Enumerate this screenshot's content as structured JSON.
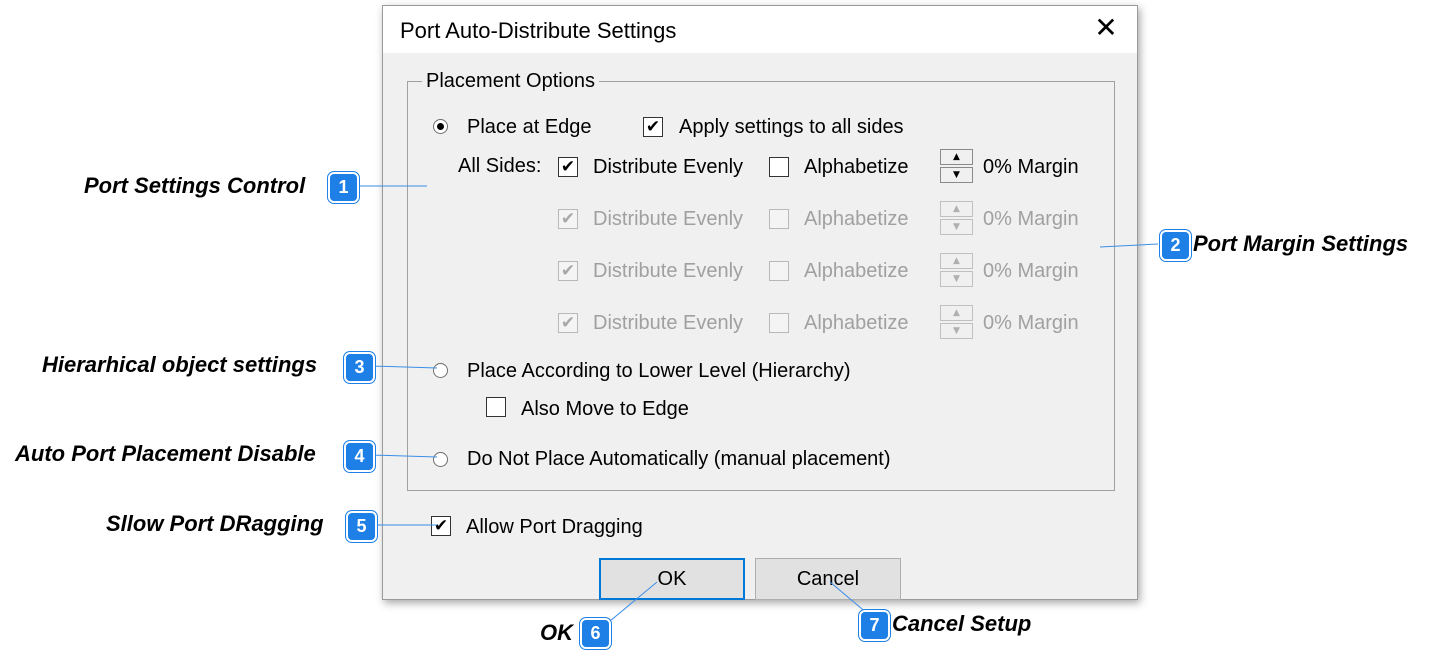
{
  "dialog": {
    "title": "Port Auto-Distribute Settings",
    "close_glyph": "✕"
  },
  "placement": {
    "group_title": "Placement Options",
    "place_at_edge": "Place at Edge",
    "apply_all_sides": "Apply settings to all sides",
    "all_sides_label": "All Sides:",
    "rows": [
      {
        "distribute": "Distribute Evenly",
        "alphabetize": "Alphabetize",
        "margin": "0% Margin",
        "distribute_checked": true,
        "alphabetize_checked": false,
        "enabled": true
      },
      {
        "distribute": "Distribute Evenly",
        "alphabetize": "Alphabetize",
        "margin": "0% Margin",
        "distribute_checked": true,
        "alphabetize_checked": false,
        "enabled": false
      },
      {
        "distribute": "Distribute Evenly",
        "alphabetize": "Alphabetize",
        "margin": "0% Margin",
        "distribute_checked": true,
        "alphabetize_checked": false,
        "enabled": false
      },
      {
        "distribute": "Distribute Evenly",
        "alphabetize": "Alphabetize",
        "margin": "0% Margin",
        "distribute_checked": true,
        "alphabetize_checked": false,
        "enabled": false
      }
    ],
    "hierarchy": "Place According to Lower Level (Hierarchy)",
    "also_move": "Also Move to Edge",
    "manual": "Do Not Place Automatically (manual placement)"
  },
  "allow_dragging": "Allow Port Dragging",
  "buttons": {
    "ok": "OK",
    "cancel": "Cancel"
  },
  "check_glyph": "✔",
  "spin_up_glyph": "▲",
  "spin_down_glyph": "▼",
  "callouts": [
    {
      "num": "1",
      "text": "Port Settings Control"
    },
    {
      "num": "2",
      "text": "Port Margin Settings"
    },
    {
      "num": "3",
      "text": "Hierarhical object settings"
    },
    {
      "num": "4",
      "text": "Auto Port Placement Disable"
    },
    {
      "num": "5",
      "text": "Sllow Port DRagging"
    },
    {
      "num": "6",
      "text": "OK"
    },
    {
      "num": "7",
      "text": "Cancel Setup"
    }
  ],
  "accent_color": "#1e7fe6"
}
